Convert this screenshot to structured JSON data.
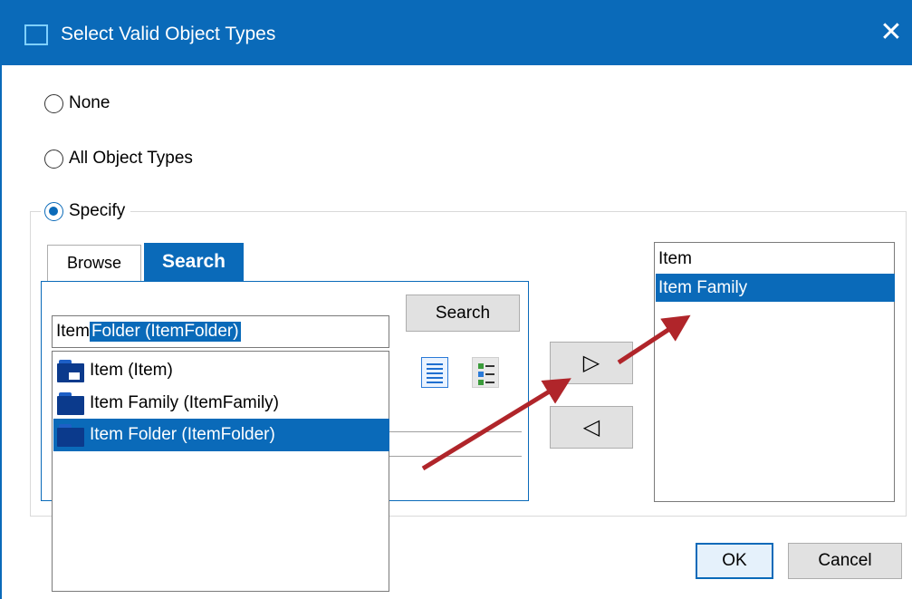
{
  "dialog": {
    "title": "Select Valid Object Types",
    "close_glyph": "✕"
  },
  "options": {
    "none_label": "None",
    "all_label": "All Object Types",
    "specify_label": "Specify",
    "selected": "specify"
  },
  "tabs": {
    "browse_label": "Browse",
    "search_label": "Search",
    "active": "search"
  },
  "search": {
    "button_label": "Search",
    "input_typed": "Item",
    "input_autocomplete_selected": " Folder (ItemFolder)"
  },
  "dropdown": {
    "items": [
      {
        "label": "Item (Item)",
        "icon": "item-type-icon"
      },
      {
        "label": "Item Family (ItemFamily)",
        "icon": "item-type-icon"
      },
      {
        "label": "Item Folder (ItemFolder)",
        "icon": "item-type-icon",
        "selected": true
      }
    ]
  },
  "view_icons": [
    "list-view-icon",
    "detail-view-icon"
  ],
  "transfer": {
    "add_glyph": "▷",
    "remove_glyph": "◁"
  },
  "selected_list": {
    "items": [
      {
        "label": "Item"
      },
      {
        "label": "Item Family",
        "selected": true
      }
    ]
  },
  "footer": {
    "ok_label": "OK",
    "cancel_label": "Cancel"
  },
  "colors": {
    "accent": "#0a6ab9",
    "annotation_arrow": "#b0252a"
  }
}
